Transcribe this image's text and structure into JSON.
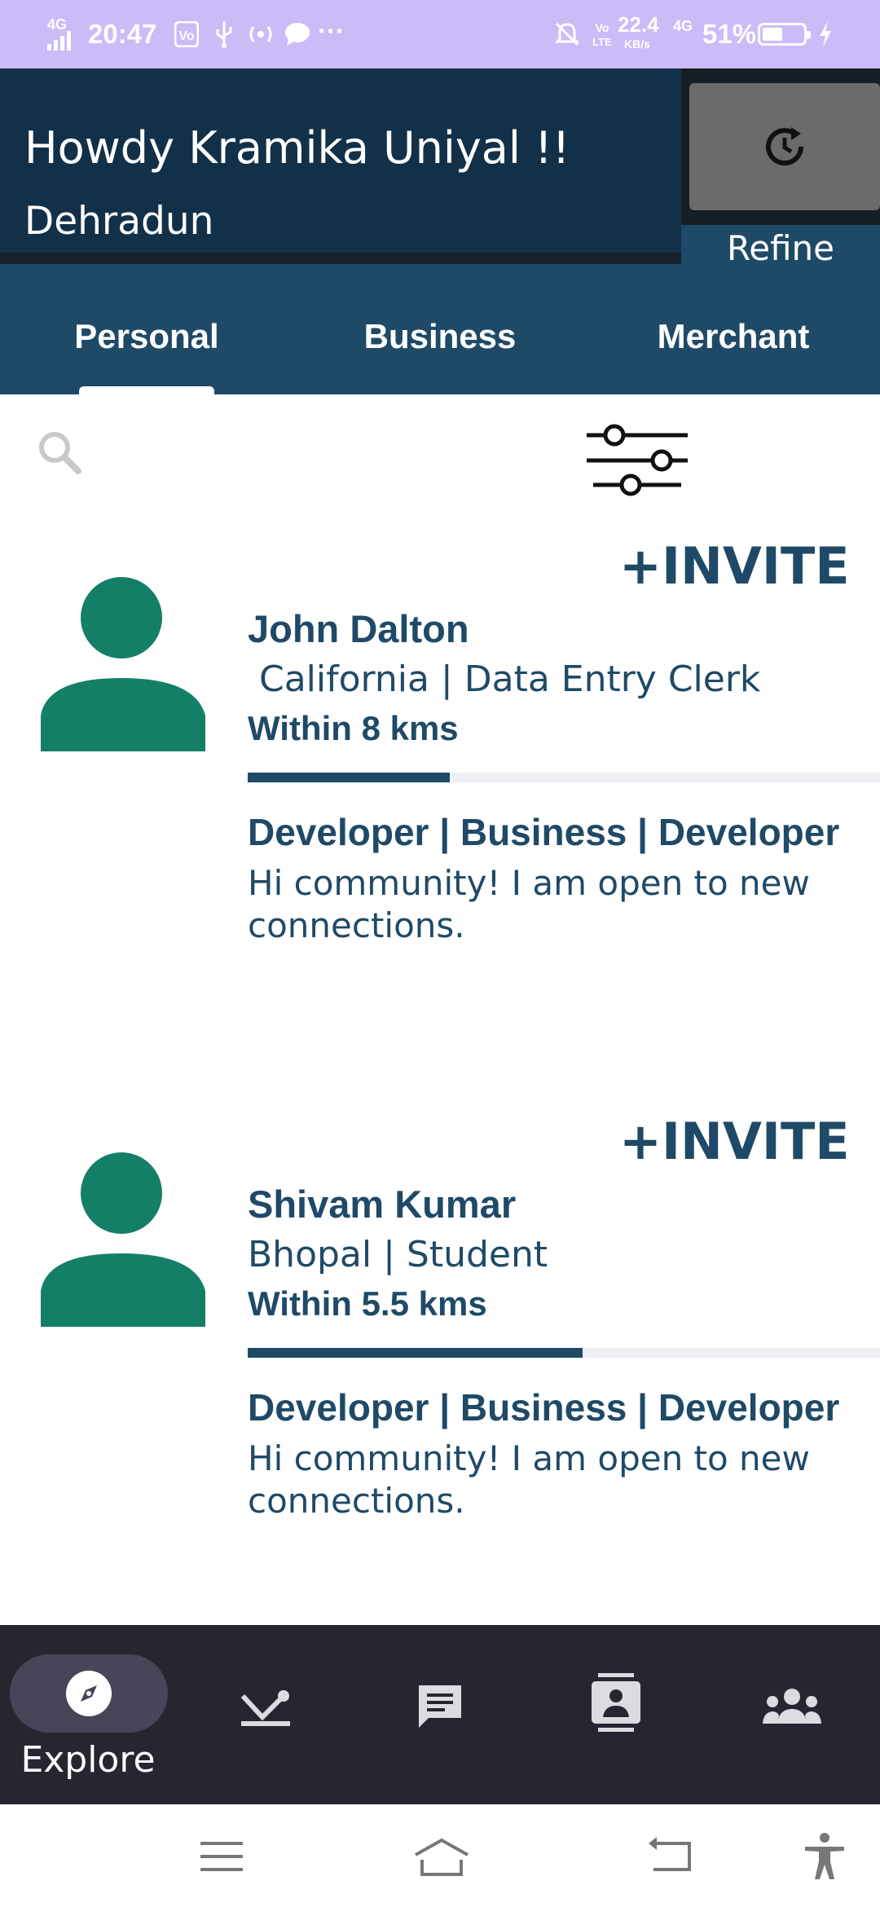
{
  "status_bar": {
    "network_left": "4G",
    "time": "20:47",
    "speed_value": "22.4",
    "speed_unit": "KB/s",
    "network_right": "4G",
    "battery": "51%"
  },
  "header": {
    "greeting": "Howdy Kramika Uniyal !!",
    "city": "Dehradun",
    "refine_label": "Refine",
    "refresh_icon": "refresh-clock-icon"
  },
  "tabs": [
    {
      "label": "Personal",
      "selected": true
    },
    {
      "label": "Business",
      "selected": false
    },
    {
      "label": "Merchant",
      "selected": false
    }
  ],
  "search": {
    "icon": "search-icon",
    "filter_icon": "sliders-icon"
  },
  "profiles": [
    {
      "invite_label": "+INVITE",
      "name": "John Dalton",
      "location": " California | Data Entry Clerk",
      "distance": "Within 8 kms",
      "progress": 0.32,
      "tags": "Developer | Business | Developer",
      "bio": "Hi community! I am open to new connections."
    },
    {
      "invite_label": "+INVITE",
      "name": "Shivam Kumar",
      "location": "Bhopal | Student",
      "distance": "Within 5.5 kms",
      "progress": 0.53,
      "tags": "Developer | Business | Developer",
      "bio": "Hi community! I am open to new connections."
    }
  ],
  "bottom_nav": {
    "explore_label": "Explore",
    "items": [
      "compass-icon",
      "inbox-arrow-icon",
      "chat-icon",
      "contact-card-icon",
      "group-icon"
    ]
  },
  "colors": {
    "primary": "#1f4a67",
    "header_dark": "#123149",
    "avatar": "#147f67",
    "status_bar": "#cbbcf7",
    "bottom_nav": "#272530"
  }
}
